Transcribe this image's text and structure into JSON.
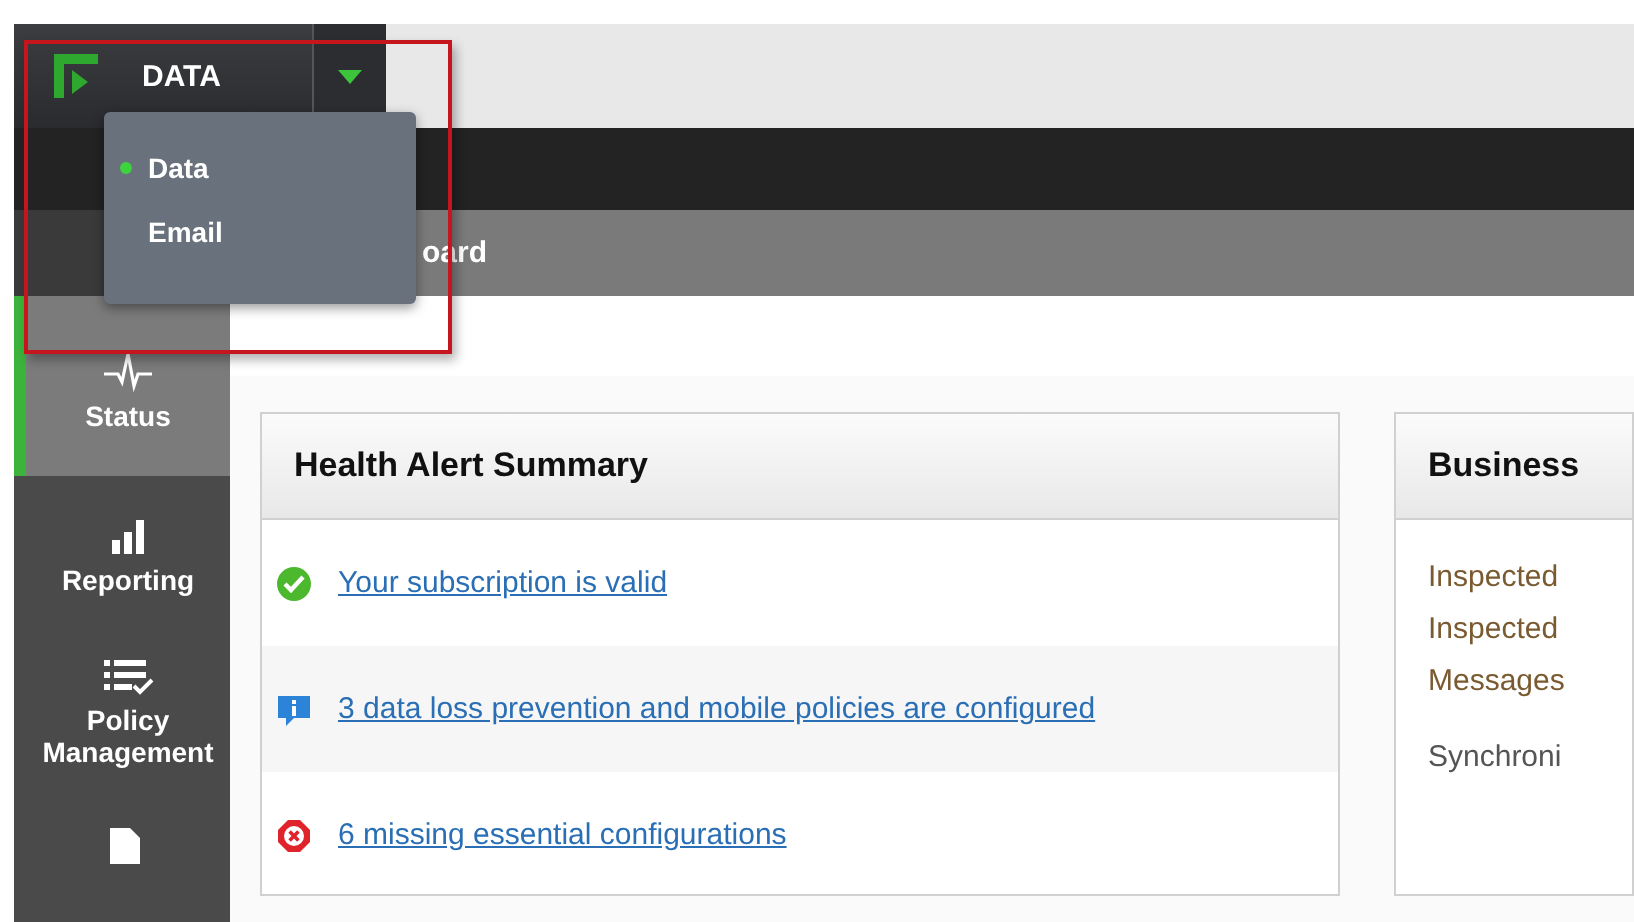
{
  "product_switcher": {
    "label": "DATA",
    "menu": [
      {
        "label": "Data",
        "selected": true
      },
      {
        "label": "Email",
        "selected": false
      }
    ]
  },
  "page_title": "oard",
  "nav": [
    {
      "label": "Status",
      "selected": true
    },
    {
      "label": "Reporting",
      "selected": false
    },
    {
      "label": "Policy Management",
      "selected": false
    },
    {
      "selected": false
    }
  ],
  "health_card": {
    "title": "Health Alert Summary",
    "alerts": [
      {
        "kind": "success",
        "text": "Your subscription is valid"
      },
      {
        "kind": "info",
        "text": "3 data loss prevention and mobile policies are configured"
      },
      {
        "kind": "error",
        "text": "6 missing essential configurations"
      }
    ]
  },
  "business_card": {
    "title": "Business",
    "lines": [
      {
        "kind": "stat",
        "text": "Inspected"
      },
      {
        "kind": "stat",
        "text": "Inspected"
      },
      {
        "kind": "stat",
        "text": "Messages"
      },
      {
        "kind": "sync",
        "text": "Synchroni"
      }
    ]
  }
}
